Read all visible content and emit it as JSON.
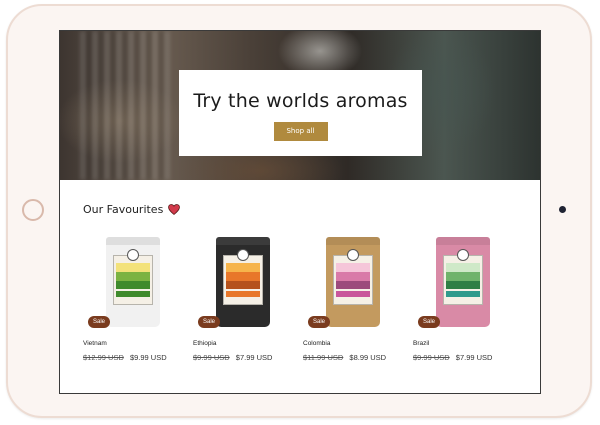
{
  "hero": {
    "title": "Try the worlds aromas",
    "button_label": "Shop all"
  },
  "favourites": {
    "title": "Our Favourites",
    "icon": "heart-icon",
    "products": [
      {
        "name": "Vietnam",
        "old_price": "$12.99 USD",
        "price": "$9.99 USD",
        "badge": "Sale",
        "bag_color": "#f1f1f1",
        "band_color": "#3f8a2c"
      },
      {
        "name": "Ethiopia",
        "old_price": "$9.99 USD",
        "price": "$7.99 USD",
        "badge": "Sale",
        "bag_color": "#2b2b2b",
        "band_color": "#e8772a"
      },
      {
        "name": "Colombia",
        "old_price": "$11.99 USD",
        "price": "$8.99 USD",
        "badge": "Sale",
        "bag_color": "#c39a5f",
        "band_color": "#c9559b"
      },
      {
        "name": "Brazil",
        "old_price": "$9.99 USD",
        "price": "$7.99 USD",
        "badge": "Sale",
        "bag_color": "#d98aa6",
        "band_color": "#2f9a8c"
      }
    ]
  },
  "colors": {
    "accent": "#b08a3e",
    "sale_badge": "#7a3b1e",
    "heart": "#d23a4b"
  }
}
